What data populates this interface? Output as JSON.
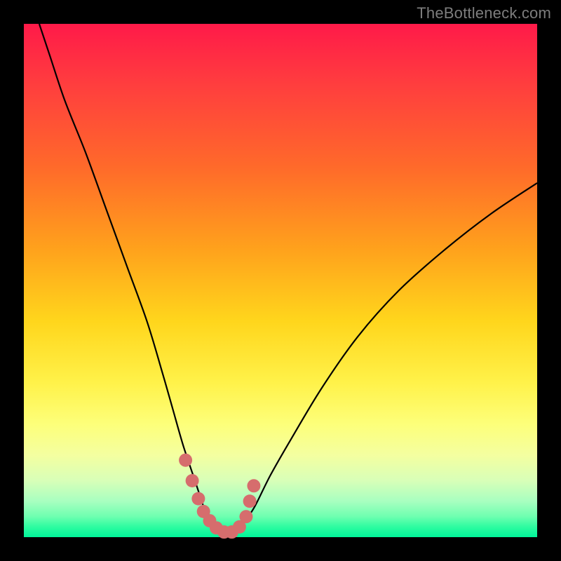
{
  "watermark": "TheBottleneck.com",
  "colors": {
    "frame": "#000000",
    "gradient_top": "#ff1a49",
    "gradient_bottom": "#00f59a",
    "dot_fill": "#d66d6d",
    "curve": "#000000"
  },
  "chart_data": {
    "type": "line",
    "title": "",
    "xlabel": "",
    "ylabel": "",
    "xlim": [
      0,
      100
    ],
    "ylim": [
      0,
      100
    ],
    "series": [
      {
        "name": "bottleneck-curve",
        "x": [
          3,
          5,
          8,
          12,
          16,
          20,
          24,
          27,
          29,
          31,
          33,
          34,
          35,
          36,
          37,
          38,
          39,
          40,
          41,
          42,
          43,
          45,
          48,
          52,
          58,
          65,
          73,
          82,
          91,
          100
        ],
        "y": [
          100,
          94,
          85,
          75,
          64,
          53,
          42,
          32,
          25,
          18,
          12,
          9,
          6,
          4,
          2.5,
          1.5,
          1,
          1,
          1.2,
          1.8,
          3,
          6,
          12,
          19,
          29,
          39,
          48,
          56,
          63,
          69
        ]
      }
    ],
    "highlight_dots": {
      "name": "optimal-range-dots",
      "x": [
        31.5,
        32.8,
        34.0,
        35.0,
        36.2,
        37.5,
        39.0,
        40.5,
        42.0,
        43.3,
        44.0,
        44.8
      ],
      "y": [
        15.0,
        11.0,
        7.5,
        5.0,
        3.2,
        1.8,
        1.0,
        1.0,
        2.0,
        4.0,
        7.0,
        10.0
      ]
    }
  }
}
